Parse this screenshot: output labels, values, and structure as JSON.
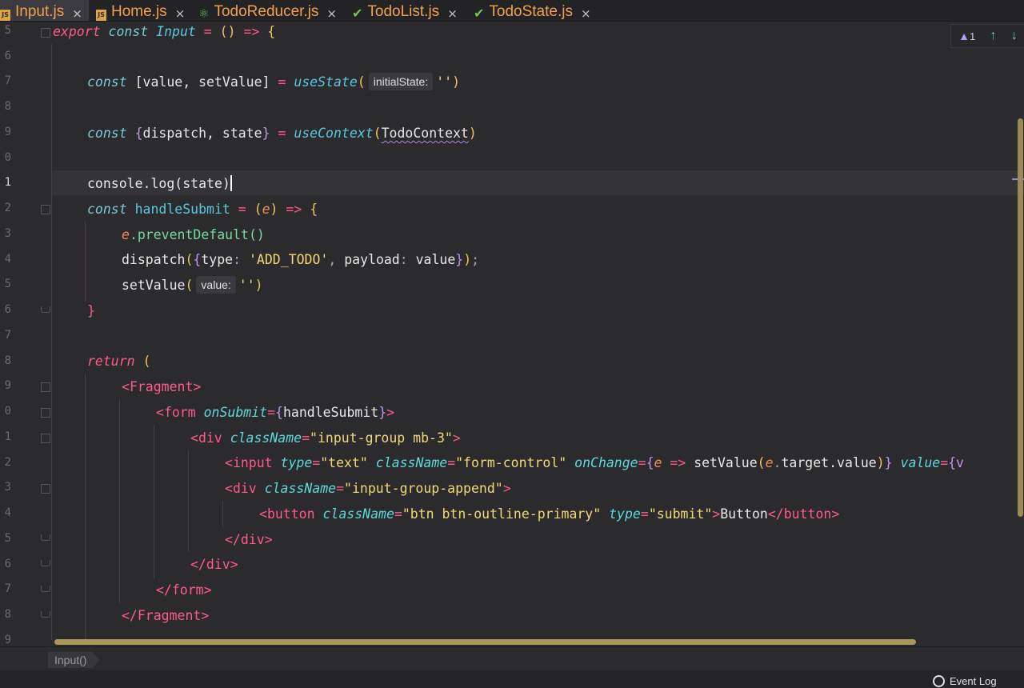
{
  "tabs": [
    {
      "label": "Input.js",
      "icon": "js-file-icon",
      "active": true
    },
    {
      "label": "Home.js",
      "icon": "js-file-icon",
      "active": false
    },
    {
      "label": "TodoReducer.js",
      "icon": "react-file-icon",
      "active": false
    },
    {
      "label": "TodoList.js",
      "icon": "component-file-icon",
      "active": false
    },
    {
      "label": "TodoState.js",
      "icon": "component-file-icon",
      "active": false
    }
  ],
  "close_glyph": "×",
  "line_numbers": [
    "5",
    "6",
    "7",
    "8",
    "9",
    "0",
    "1",
    "2",
    "3",
    "4",
    "5",
    "6",
    "7",
    "8",
    "9",
    "0",
    "1",
    "2",
    "3",
    "4",
    "5",
    "6",
    "7",
    "8",
    "9"
  ],
  "code": {
    "l5": {
      "kw_export": "export",
      "kw_const": "const",
      "name": "Input",
      "eq": "=",
      "parens": "()",
      "arrow": "=>",
      "brace": "{"
    },
    "l7": {
      "kw": "const",
      "destructure": "[value, setValue]",
      "eq": "=",
      "fn": "useState",
      "hint": "initialState:",
      "arg": "''"
    },
    "l9": {
      "kw": "const",
      "lbrace": "{",
      "destructure": "dispatch, state",
      "rbrace": "}",
      "eq": "=",
      "fn": "useContext",
      "arg": "TodoContext"
    },
    "l11": {
      "text": "console.log(state)"
    },
    "l12": {
      "kw": "const",
      "name": "handleSubmit",
      "eq": "=",
      "param": "e",
      "arrow": "=>",
      "brace": "{"
    },
    "l13": {
      "param": "e",
      "call": ".preventDefault()"
    },
    "l14": {
      "fn": "dispatch",
      "type_key": "type",
      "type_val": "'ADD_TODO'",
      "payload_key": "payload",
      "payload_val": "value"
    },
    "l15": {
      "fn": "setValue",
      "hint": "value:",
      "arg": "''"
    },
    "l16": {
      "brace": "}"
    },
    "l18": {
      "kw": "return",
      "paren": "("
    },
    "l19": {
      "tag": "Fragment"
    },
    "l20": {
      "tag": "form",
      "attr": "onSubmit",
      "value": "handleSubmit"
    },
    "l21": {
      "tag": "div",
      "attr": "className",
      "value": "\"input-group mb-3\""
    },
    "l22": {
      "tag": "input",
      "attr1": "type",
      "val1": "\"text\"",
      "attr2": "className",
      "val2": "\"form-control\"",
      "attr3": "onChange",
      "param": "e",
      "arrow": "=>",
      "call": "setValue",
      "expr": "target.value",
      "attr4": "value",
      "tail": "{v"
    },
    "l23": {
      "tag": "div",
      "attr": "className",
      "value": "\"input-group-append\""
    },
    "l24": {
      "tag": "button",
      "attr1": "className",
      "val1": "\"btn btn-outline-primary\"",
      "attr2": "type",
      "val2": "\"submit\"",
      "text": "Button"
    },
    "l25": {
      "tag": "div"
    },
    "l26": {
      "tag": "div"
    },
    "l27": {
      "tag": "form"
    },
    "l28": {
      "tag": "Fragment"
    }
  },
  "inspection": {
    "warning_count": "1"
  },
  "breadcrumb": "Input()",
  "status": {
    "event_log": "Event Log"
  }
}
